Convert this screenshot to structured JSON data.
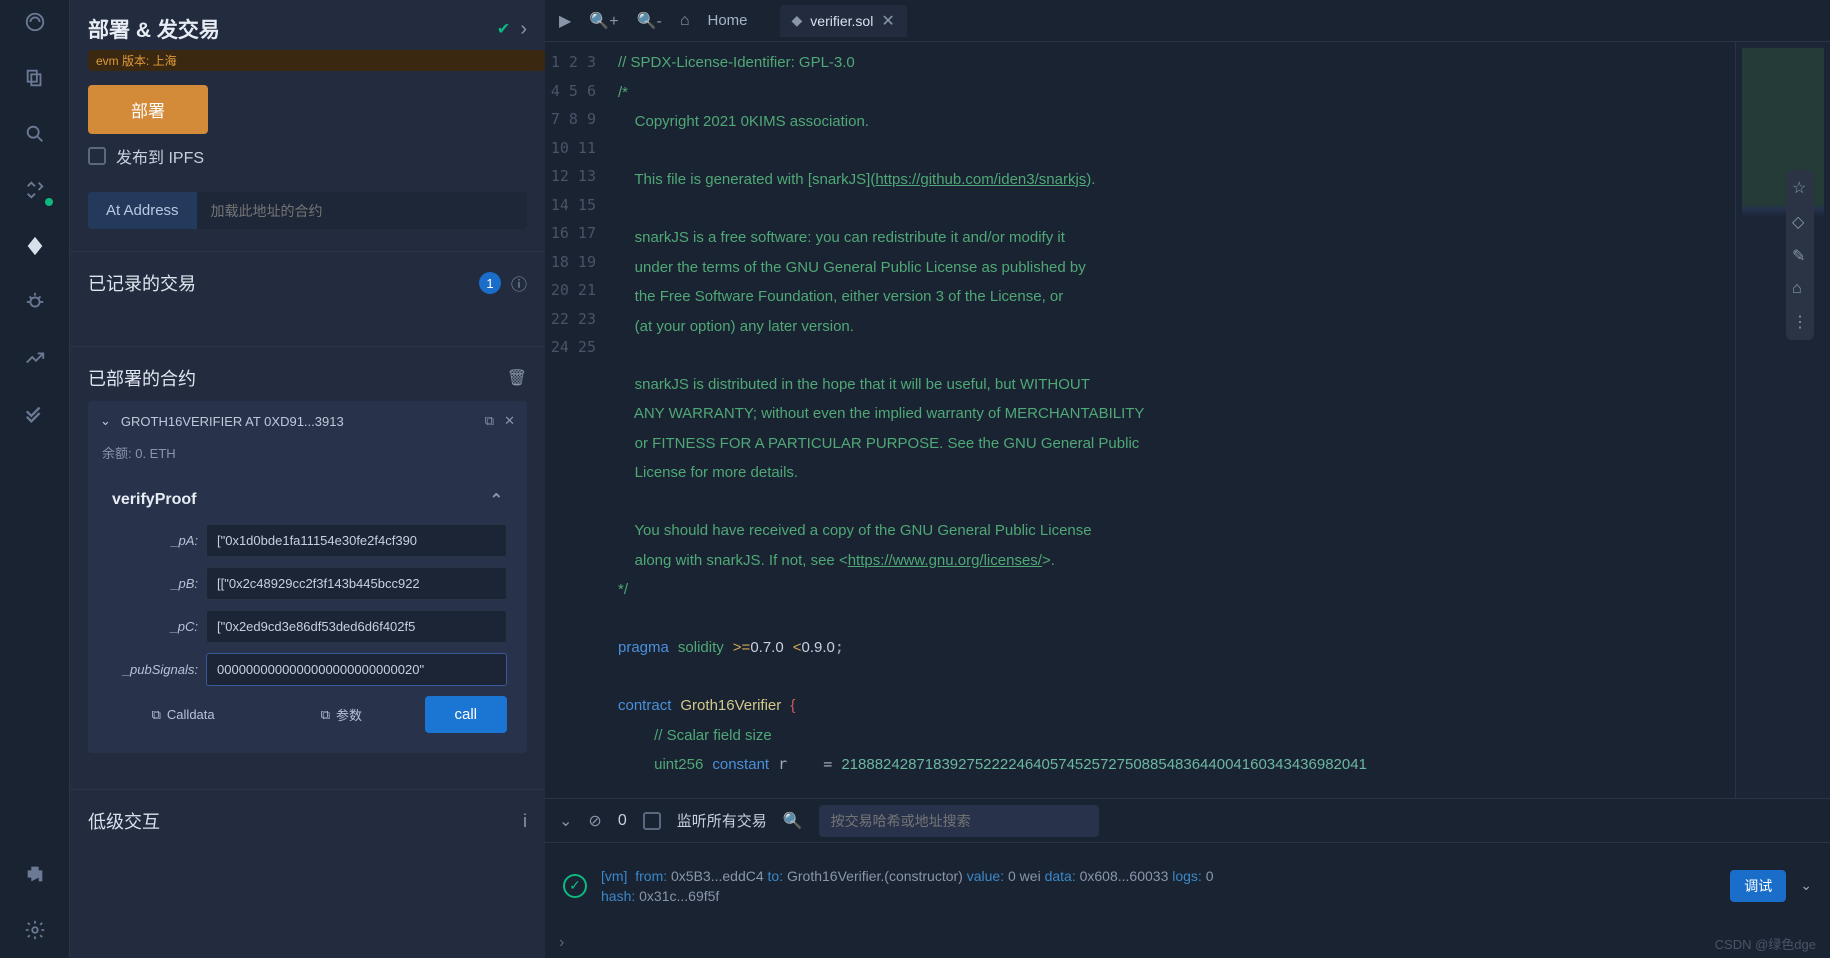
{
  "panel": {
    "title": "部署 & 发交易",
    "evm_tag": "evm 版本: 上海",
    "deploy_btn": "部署",
    "ipfs_label": "发布到 IPFS",
    "at_address_btn": "At Address",
    "at_address_placeholder": "加载此地址的合约"
  },
  "transactions": {
    "title": "已记录的交易",
    "count": "1"
  },
  "deployed": {
    "title": "已部署的合约",
    "contract_name": "GROTH16VERIFIER AT 0XD91...3913",
    "balance": "余额: 0. ETH",
    "fn_name": "verifyProof",
    "params": {
      "pA_label": "_pA:",
      "pA_val": "[\"0x1d0bde1fa11154e30fe2f4cf390",
      "pB_label": "_pB:",
      "pB_val": "[[\"0x2c48929cc2f3f143b445bcc922",
      "pC_label": "_pC:",
      "pC_val": "[\"0x2ed9cd3e86df53ded6d6f402f5",
      "pub_label": "_pubSignals:",
      "pub_val": "0000000000000000000000000020\""
    },
    "calldata_btn": "Calldata",
    "params_btn": "参数",
    "call_btn": "call"
  },
  "lowlevel": "低级交互",
  "tabs": {
    "home": "Home",
    "file": "verifier.sol"
  },
  "code": {
    "lines": [
      {
        "n": "1",
        "html": "<span class='c-comment'>// SPDX-License-Identifier: GPL-3.0</span>"
      },
      {
        "n": "2",
        "html": "<span class='c-comment'>/*</span>"
      },
      {
        "n": "3",
        "html": "<span class='c-comment'>    Copyright 2021 0KIMS association.</span>"
      },
      {
        "n": "4",
        "html": ""
      },
      {
        "n": "5",
        "html": "<span class='c-comment'>    This file is generated with [snarkJS](</span><span class='c-link'>https://github.com/iden3/snarkjs</span><span class='c-comment'>).</span>"
      },
      {
        "n": "6",
        "html": ""
      },
      {
        "n": "7",
        "html": "<span class='c-comment'>    snarkJS is a free software: you can redistribute it and/or modify it</span>"
      },
      {
        "n": "8",
        "html": "<span class='c-comment'>    under the terms of the GNU General Public License as published by</span>"
      },
      {
        "n": "9",
        "html": "<span class='c-comment'>    the Free Software Foundation, either version 3 of the License, or</span>"
      },
      {
        "n": "10",
        "html": "<span class='c-comment'>    (at your option) any later version.</span>"
      },
      {
        "n": "11",
        "html": ""
      },
      {
        "n": "12",
        "html": "<span class='c-comment'>    snarkJS is distributed in the hope that it will be useful, but WITHOUT</span>"
      },
      {
        "n": "13",
        "html": "<span class='c-comment'>    ANY WARRANTY; without even the implied warranty of MERCHANTABILITY</span>"
      },
      {
        "n": "14",
        "html": "<span class='c-comment'>    or FITNESS FOR A PARTICULAR PURPOSE. See the GNU General Public</span>"
      },
      {
        "n": "15",
        "html": "<span class='c-comment'>    License for more details.</span>"
      },
      {
        "n": "16",
        "html": ""
      },
      {
        "n": "17",
        "html": "<span class='c-comment'>    You should have received a copy of the GNU General Public License</span>"
      },
      {
        "n": "18",
        "html": "<span class='c-comment'>    along with snarkJS. If not, see &lt;</span><span class='c-link'>https://www.gnu.org/licenses/</span><span class='c-comment'>&gt;.</span>"
      },
      {
        "n": "19",
        "html": "<span class='c-comment'>*/</span>"
      },
      {
        "n": "20",
        "html": ""
      },
      {
        "n": "21",
        "html": "<span class='c-kw'>pragma</span> <span class='c-type'>solidity</span> <span class='c-op'>&gt;=</span><span class='c-ver'>0.7.0</span> <span class='c-op'>&lt;</span><span class='c-ver'>0.9.0</span>;"
      },
      {
        "n": "22",
        "html": ""
      },
      {
        "n": "23",
        "html": "<span class='c-kw'>contract</span> <span class='c-name'>Groth16Verifier</span> <span class='c-brace'>{</span>"
      },
      {
        "n": "24",
        "html": "    <span class='c-comment'>// Scalar field size</span>"
      },
      {
        "n": "25",
        "html": "    <span class='c-type'>uint256</span> <span class='c-const'>constant</span> r    = <span class='c-num'>218882428718392752222464057452572750885483644004160343436982041</span>"
      }
    ]
  },
  "console": {
    "zero": "0",
    "listen": "监听所有交易",
    "search_placeholder": "按交易哈希或地址搜索",
    "log": {
      "vm": "[vm]",
      "from_lbl": "from:",
      "from": "0x5B3...eddC4",
      "to_lbl": "to:",
      "to": "Groth16Verifier.(constructor)",
      "value_lbl": "value:",
      "value": "0 wei",
      "data_lbl": "data:",
      "data": "0x608...60033",
      "logs_lbl": "logs:",
      "logs": "0",
      "hash_lbl": "hash:",
      "hash": "0x31c...69f5f"
    },
    "debug_btn": "调试"
  },
  "watermark": "CSDN @绿色dge"
}
